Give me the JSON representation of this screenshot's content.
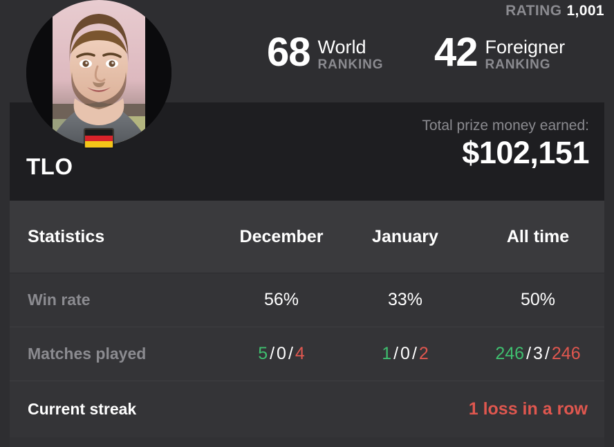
{
  "header": {
    "rating_label": "RATING",
    "rating_value": "1,001",
    "rankings": [
      {
        "number": "68",
        "scope": "World",
        "word": "RANKING"
      },
      {
        "number": "42",
        "scope": "Foreigner",
        "word": "RANKING"
      }
    ]
  },
  "profile": {
    "player_name": "TLO",
    "country_flag": "germany-flag-icon",
    "avatar": "player-avatar-photo",
    "prize_label": "Total prize money earned:",
    "prize_value": "$102,151"
  },
  "statistics": {
    "title": "Statistics",
    "columns": [
      "December",
      "January",
      "All time"
    ],
    "rows": [
      {
        "label": "Win rate",
        "values": [
          "56%",
          "33%",
          "50%"
        ]
      },
      {
        "label": "Matches played",
        "records": [
          {
            "wins": "5",
            "draws": "0",
            "losses": "4"
          },
          {
            "wins": "1",
            "draws": "0",
            "losses": "2"
          },
          {
            "wins": "246",
            "draws": "3",
            "losses": "246"
          }
        ],
        "separator": "/"
      }
    ],
    "streak": {
      "label": "Current streak",
      "value": "1 loss in a row"
    }
  },
  "colors": {
    "win_green": "#3fbf6f",
    "loss_red": "#e0574f",
    "muted_text": "#8b8b90",
    "white_text": "#ffffff",
    "header_bg": "#2e2e31",
    "profile_bg": "#1e1e21",
    "stats_bg": "#343437",
    "stats_header_bg": "#3a3a3d"
  }
}
